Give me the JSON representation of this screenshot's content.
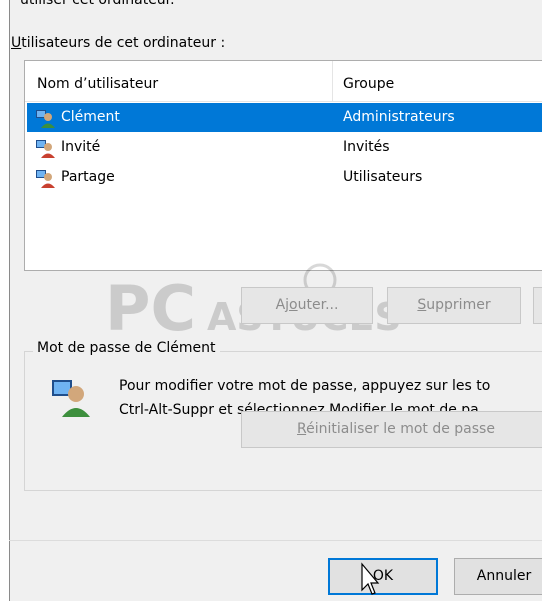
{
  "top_cut_text": "utiliser cet ordinateur.",
  "users_label": {
    "underlined": "U",
    "rest": "tilisateurs de cet ordinateur :"
  },
  "listview": {
    "columns": [
      "Nom d’utilisateur",
      "Groupe"
    ],
    "rows": [
      {
        "name": "Clément",
        "group": "Administrateurs",
        "selected": true,
        "icon": "user-admin-icon"
      },
      {
        "name": "Invité",
        "group": "Invités",
        "selected": false,
        "icon": "user-icon"
      },
      {
        "name": "Partage",
        "group": "Utilisateurs",
        "selected": false,
        "icon": "user-icon"
      }
    ]
  },
  "buttons": {
    "add": {
      "underlined": "o",
      "label_pre": "Aj",
      "label_post": "uter...",
      "enabled": false
    },
    "remove": {
      "underlined": "S",
      "label_post": "upprimer",
      "enabled": false
    },
    "reset_password": {
      "underlined": "R",
      "label_post": "éinitialiser le mot de passe",
      "enabled": false
    },
    "ok": {
      "underlined": "",
      "label": "OK",
      "enabled": true
    },
    "cancel": {
      "label": "Annuler",
      "enabled": true
    }
  },
  "password_group": {
    "title": "Mot de passe de Clément",
    "text_line1": "Pour modifier votre mot de passe, appuyez sur les to",
    "text_line2": "Ctrl-Alt-Suppr et sélectionnez Modifier le mot de pa",
    "icon": "user-key-icon"
  },
  "watermark": {
    "brand": "PC",
    "brand2": "ASTUCES"
  },
  "colors": {
    "selection": "#0078d7",
    "dialog_bg": "#f0f0f0",
    "button_bg": "#e1e1e1",
    "disabled_text": "#8c8c8c"
  }
}
